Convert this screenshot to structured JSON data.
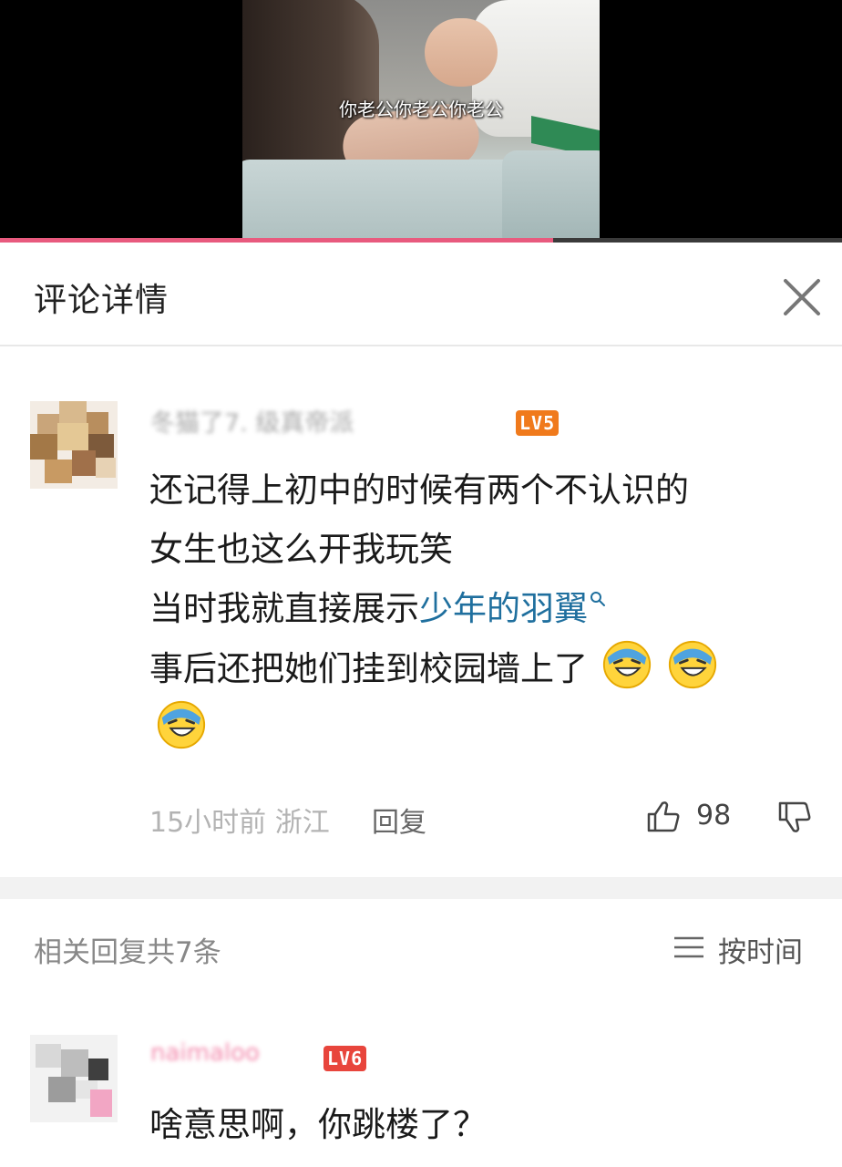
{
  "video": {
    "subtitle": "你老公你老公你老公",
    "progress": 0.657
  },
  "header": {
    "title": "评论详情",
    "close_icon": "close-icon"
  },
  "main_comment": {
    "username": "冬猫了7.  级真帝派",
    "level_badge": "LV5",
    "lines": [
      "还记得上初中的时候有两个不认识的",
      "女生也这么开我玩笑"
    ],
    "line3_prefix": "当时我就直接展示",
    "line3_link": "少年的羽翼",
    "line4": "事后还把她们挂到校园墙上了",
    "emoji": "laughing-tears-emoji",
    "time": "15小时前",
    "location": "浙江",
    "reply_label": "回复",
    "like_count": "98",
    "badge_color": "#f07a1c",
    "link_color": "#1f6f9e"
  },
  "replies": {
    "count_label": "相关回复共7条",
    "sort_label": "按时间"
  },
  "reply": {
    "username": "naimaloo",
    "level_badge": "LV6",
    "text": "啥意思啊，你跳楼了？"
  }
}
